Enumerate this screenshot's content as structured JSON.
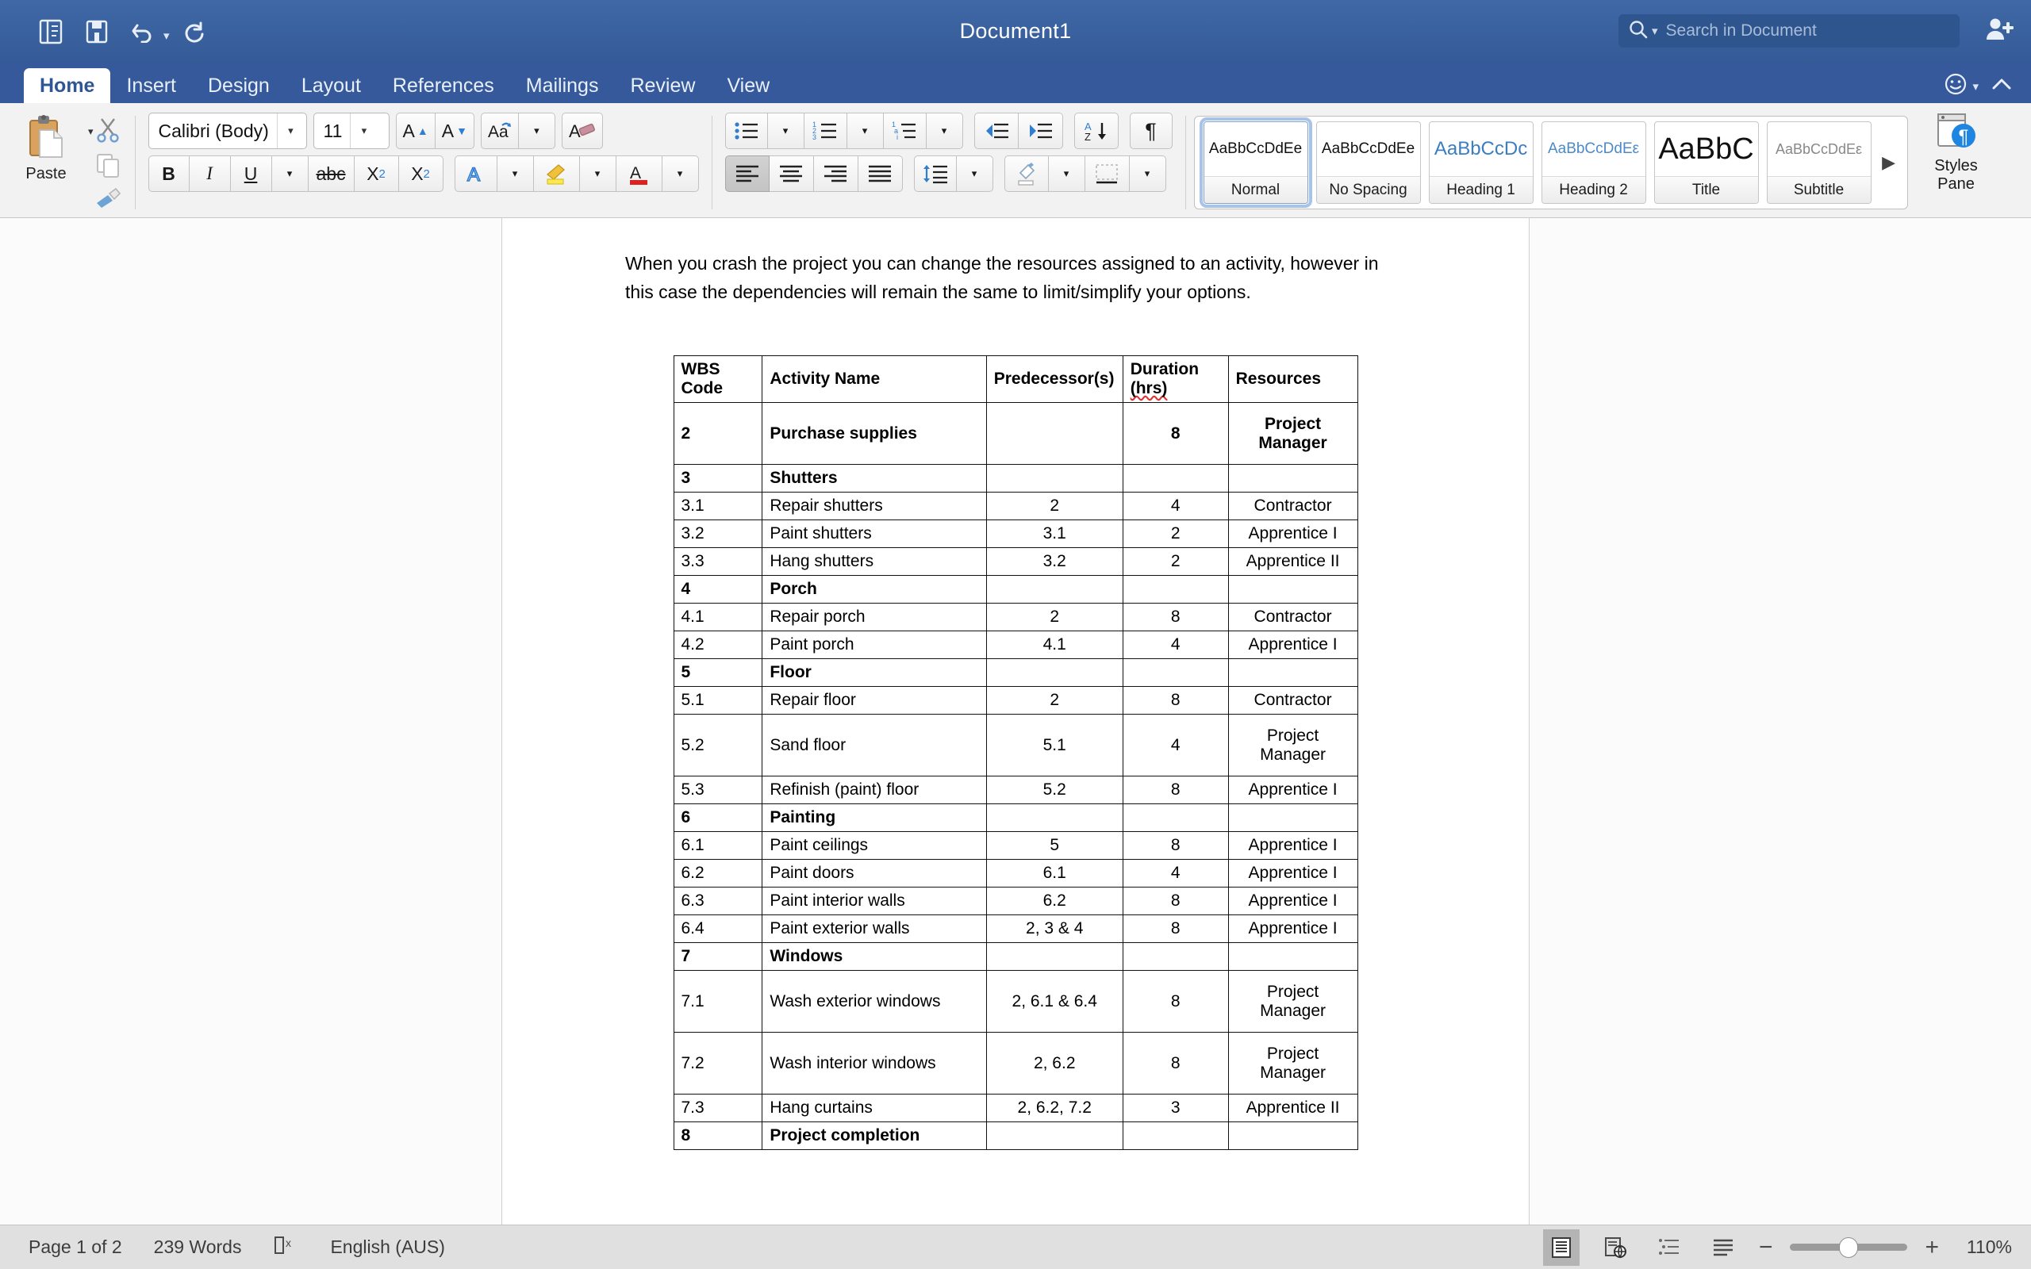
{
  "titlebar": {
    "document_title": "Document1",
    "quick_access": [
      {
        "name": "sidebar-toggle-icon",
        "label": "Sidebar"
      },
      {
        "name": "save-icon",
        "label": "Save"
      },
      {
        "name": "undo-icon",
        "label": "Undo"
      },
      {
        "name": "redo-icon",
        "label": "Redo"
      }
    ],
    "search_placeholder": "Search in Document",
    "search_value": "",
    "share_icon": "person-add-icon",
    "colors": {
      "bar": "#3a62a0",
      "search_field": "#2f558f"
    }
  },
  "ribbon": {
    "tabs": [
      {
        "label": "Home",
        "active": true
      },
      {
        "label": "Insert",
        "active": false
      },
      {
        "label": "Design",
        "active": false
      },
      {
        "label": "Layout",
        "active": false
      },
      {
        "label": "References",
        "active": false
      },
      {
        "label": "Mailings",
        "active": false
      },
      {
        "label": "Review",
        "active": false
      },
      {
        "label": "View",
        "active": false
      }
    ],
    "right_icons": [
      {
        "name": "smiley-icon",
        "label": "Feedback"
      },
      {
        "name": "chevron-up-icon",
        "label": "Collapse Ribbon"
      }
    ],
    "clipboard": {
      "paste_label": "Paste",
      "cut_label": "Cut",
      "copy_label": "Copy",
      "format_painter_label": "Format Painter"
    },
    "font": {
      "font_name": "Calibri (Body)",
      "font_size": "11",
      "grow_label": "Grow Font",
      "shrink_label": "Shrink Font",
      "change_case_label": "Change Case",
      "clear_formatting_label": "Clear Formatting",
      "bold_label": "B",
      "italic_label": "I",
      "underline_label": "U",
      "strikethrough_label": "abc",
      "subscript_label": "X",
      "subscript_sub": "2",
      "superscript_label": "X",
      "superscript_sup": "2",
      "text_effects_label": "A",
      "highlight_label": "Text Highlight Color",
      "font_color_label": "A"
    },
    "paragraph": {
      "bullets_label": "Bullets",
      "numbering_label": "Numbering",
      "multilevel_label": "Multilevel List",
      "decrease_indent_label": "Decrease Indent",
      "increase_indent_label": "Increase Indent",
      "sort_label": "Sort",
      "show_marks_label": "¶",
      "align_left_label": "Align Left",
      "align_center_label": "Center",
      "align_right_label": "Align Right",
      "justify_label": "Justify",
      "line_spacing_label": "Line Spacing",
      "shading_label": "Shading",
      "borders_label": "Borders"
    },
    "styles": {
      "items": [
        {
          "preview": "AaBbCcDdEe",
          "name": "Normal",
          "selected": true,
          "kind": "normal"
        },
        {
          "preview": "AaBbCcDdEe",
          "name": "No Spacing",
          "selected": false,
          "kind": "normal"
        },
        {
          "preview": "AaBbCcDc",
          "name": "Heading 1",
          "selected": false,
          "kind": "h1"
        },
        {
          "preview": "AaBbCcDdEε",
          "name": "Heading 2",
          "selected": false,
          "kind": "h2"
        },
        {
          "preview": "AaBbC",
          "name": "Title",
          "selected": false,
          "kind": "title"
        },
        {
          "preview": "AaBbCcDdEε",
          "name": "Subtitle",
          "selected": false,
          "kind": "subtitle"
        }
      ],
      "more_arrow": "▶",
      "pane_label_line1": "Styles",
      "pane_label_line2": "Pane"
    }
  },
  "document": {
    "paragraph_text": "When you crash the project you can change the resources assigned to an activity, however in this case the dependencies will remain the same to limit/simplify your options.",
    "table": {
      "headers": [
        "WBS Code",
        "Activity Name",
        "Predecessor(s)",
        "Duration (hrs)",
        "Resources"
      ],
      "header_wbs_line1": "WBS",
      "header_wbs_line2": "Code",
      "header_activity": "Activity Name",
      "header_pred": "Predecessor(s)",
      "header_dur_line1": "Duration",
      "header_dur_line2": "(hrs)",
      "header_res": "Resources",
      "rows": [
        {
          "code": "2",
          "activity": "Purchase supplies",
          "pred": "",
          "dur": "8",
          "res": "Project Manager",
          "bold": true,
          "tall": true
        },
        {
          "code": "3",
          "activity": "Shutters",
          "pred": "",
          "dur": "",
          "res": "",
          "bold": true,
          "tall": false
        },
        {
          "code": "3.1",
          "activity": "Repair shutters",
          "pred": "2",
          "dur": "4",
          "res": "Contractor",
          "bold": false,
          "tall": false
        },
        {
          "code": "3.2",
          "activity": "Paint shutters",
          "pred": "3.1",
          "dur": "2",
          "res": "Apprentice I",
          "bold": false,
          "tall": false
        },
        {
          "code": "3.3",
          "activity": "Hang shutters",
          "pred": "3.2",
          "dur": "2",
          "res": "Apprentice II",
          "bold": false,
          "tall": false
        },
        {
          "code": "4",
          "activity": "Porch",
          "pred": "",
          "dur": "",
          "res": "",
          "bold": true,
          "tall": false
        },
        {
          "code": "4.1",
          "activity": "Repair porch",
          "pred": "2",
          "dur": "8",
          "res": "Contractor",
          "bold": false,
          "tall": false
        },
        {
          "code": "4.2",
          "activity": "Paint porch",
          "pred": "4.1",
          "dur": "4",
          "res": "Apprentice I",
          "bold": false,
          "tall": false
        },
        {
          "code": "5",
          "activity": "Floor",
          "pred": "",
          "dur": "",
          "res": "",
          "bold": true,
          "tall": false
        },
        {
          "code": "5.1",
          "activity": "Repair floor",
          "pred": "2",
          "dur": "8",
          "res": "Contractor",
          "bold": false,
          "tall": false
        },
        {
          "code": "5.2",
          "activity": "Sand floor",
          "pred": "5.1",
          "dur": "4",
          "res": "Project Manager",
          "bold": false,
          "tall": true
        },
        {
          "code": "5.3",
          "activity": "Refinish (paint) floor",
          "pred": "5.2",
          "dur": "8",
          "res": "Apprentice I",
          "bold": false,
          "tall": false
        },
        {
          "code": "6",
          "activity": "Painting",
          "pred": "",
          "dur": "",
          "res": "",
          "bold": true,
          "tall": false
        },
        {
          "code": "6.1",
          "activity": "Paint ceilings",
          "pred": "5",
          "dur": "8",
          "res": "Apprentice I",
          "bold": false,
          "tall": false
        },
        {
          "code": "6.2",
          "activity": "Paint doors",
          "pred": "6.1",
          "dur": "4",
          "res": "Apprentice I",
          "bold": false,
          "tall": false
        },
        {
          "code": "6.3",
          "activity": "Paint interior walls",
          "pred": "6.2",
          "dur": "8",
          "res": "Apprentice I",
          "bold": false,
          "tall": false
        },
        {
          "code": "6.4",
          "activity": "Paint exterior walls",
          "pred": "2, 3 & 4",
          "dur": "8",
          "res": "Apprentice I",
          "bold": false,
          "tall": false
        },
        {
          "code": "7",
          "activity": "Windows",
          "pred": "",
          "dur": "",
          "res": "",
          "bold": true,
          "tall": false
        },
        {
          "code": "7.1",
          "activity": "Wash exterior windows",
          "pred": "2, 6.1 & 6.4",
          "dur": "8",
          "res": "Project Manager",
          "bold": false,
          "tall": true
        },
        {
          "code": "7.2",
          "activity": "Wash interior windows",
          "pred": "2, 6.2",
          "dur": "8",
          "res": "Project Manager",
          "bold": false,
          "tall": true
        },
        {
          "code": "7.3",
          "activity": "Hang curtains",
          "pred": "2, 6.2, 7.2",
          "dur": "3",
          "res": "Apprentice II",
          "bold": false,
          "tall": false
        },
        {
          "code": "8",
          "activity": "Project completion",
          "pred": "",
          "dur": "",
          "res": "",
          "bold": true,
          "tall": false
        }
      ]
    }
  },
  "statusbar": {
    "page_info": "Page 1 of 2",
    "word_count": "239 Words",
    "proofing_icon": "proofing-errors-icon",
    "language": "English (AUS)",
    "views": [
      {
        "name": "print-layout-view-button",
        "label": "Print Layout",
        "active": true
      },
      {
        "name": "web-layout-view-button",
        "label": "Web Layout",
        "active": false
      },
      {
        "name": "outline-view-button",
        "label": "Outline",
        "active": false
      },
      {
        "name": "draft-view-button",
        "label": "Draft",
        "active": false
      }
    ],
    "zoom_out_label": "−",
    "zoom_in_label": "+",
    "zoom_level": "110%"
  }
}
